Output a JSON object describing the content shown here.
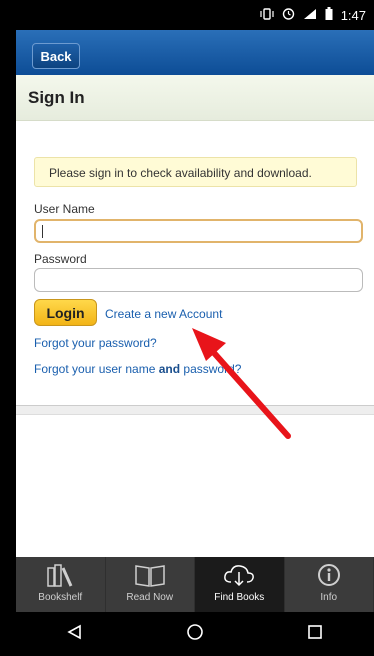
{
  "status_bar": {
    "time": "1:47",
    "icons": [
      "vibrate-icon",
      "alarm-icon",
      "signal-icon",
      "battery-icon"
    ]
  },
  "navbar": {
    "back_label": "Back"
  },
  "page": {
    "title": "Sign In"
  },
  "notice": {
    "text": "Please sign in to check availability and download."
  },
  "form": {
    "username_label": "User Name",
    "username_value": "",
    "password_label": "Password",
    "password_value": "",
    "login_label": "Login",
    "create_account_link": "Create a new Account",
    "forgot_password_link": "Forgot your password?",
    "forgot_username_prefix": "Forgot your user name ",
    "forgot_username_and": "and",
    "forgot_username_suffix": " password?"
  },
  "tabs": [
    {
      "label": "Bookshelf",
      "icon": "bookshelf-icon",
      "active": false
    },
    {
      "label": "Read Now",
      "icon": "open-book-icon",
      "active": false
    },
    {
      "label": "Find Books",
      "icon": "cloud-download-icon",
      "active": true
    },
    {
      "label": "Info",
      "icon": "info-icon",
      "active": false
    }
  ],
  "system_nav": [
    "back-triangle-icon",
    "home-circle-icon",
    "recents-square-icon"
  ],
  "colors": {
    "navbar": "#0d4d96",
    "login_button": "#f2b417",
    "link": "#1a5fae",
    "arrow": "#e8141a",
    "tabbar": "#3b3b3b"
  }
}
